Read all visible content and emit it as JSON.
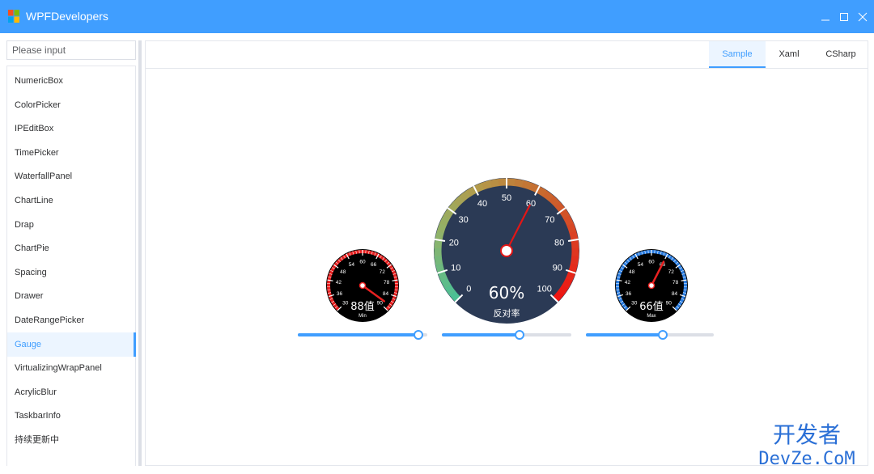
{
  "window": {
    "title": "WPFDevelopers",
    "logo_icon": "wpf-developers-logo-icon",
    "accent": "#409eff"
  },
  "sidebar": {
    "search_placeholder": "Please input",
    "items": [
      {
        "label": "NumericBox"
      },
      {
        "label": "ColorPicker"
      },
      {
        "label": "IPEditBox"
      },
      {
        "label": "TimePicker"
      },
      {
        "label": "WaterfallPanel"
      },
      {
        "label": "ChartLine"
      },
      {
        "label": "Drap"
      },
      {
        "label": "ChartPie"
      },
      {
        "label": "Spacing"
      },
      {
        "label": "Drawer"
      },
      {
        "label": "DateRangePicker"
      },
      {
        "label": "Gauge"
      },
      {
        "label": "VirtualizingWrapPanel"
      },
      {
        "label": "AcrylicBlur"
      },
      {
        "label": "TaskbarInfo"
      },
      {
        "label": "持续更新中"
      }
    ],
    "active_index": 11
  },
  "tabs": [
    {
      "label": "Sample",
      "active": true
    },
    {
      "label": "Xaml",
      "active": false
    },
    {
      "label": "CSharp",
      "active": false
    }
  ],
  "gauges": [
    {
      "id": "left",
      "value": 88,
      "value_text": "88值",
      "sub_label": "Min",
      "ticks": [
        "30",
        "36",
        "42",
        "48",
        "54",
        "60",
        "66",
        "72",
        "78",
        "84",
        "90"
      ],
      "ring_color": "#e82121",
      "slider_fraction": 0.93
    },
    {
      "id": "center",
      "value": 60,
      "value_text": "60%",
      "sub_label": "反对率",
      "ticks": [
        "0",
        "10",
        "20",
        "30",
        "40",
        "50",
        "60",
        "70",
        "80",
        "90",
        "100"
      ],
      "slider_fraction": 0.6
    },
    {
      "id": "right",
      "value": 66,
      "value_text": "66值",
      "sub_label": "Max",
      "ticks": [
        "30",
        "36",
        "42",
        "48",
        "54",
        "60",
        "66",
        "72",
        "78",
        "84",
        "90"
      ],
      "ring_color": "#2a7de1",
      "slider_fraction": 0.6
    }
  ],
  "watermark": {
    "line1": "开发者",
    "line2": "DevZe.CoM"
  }
}
